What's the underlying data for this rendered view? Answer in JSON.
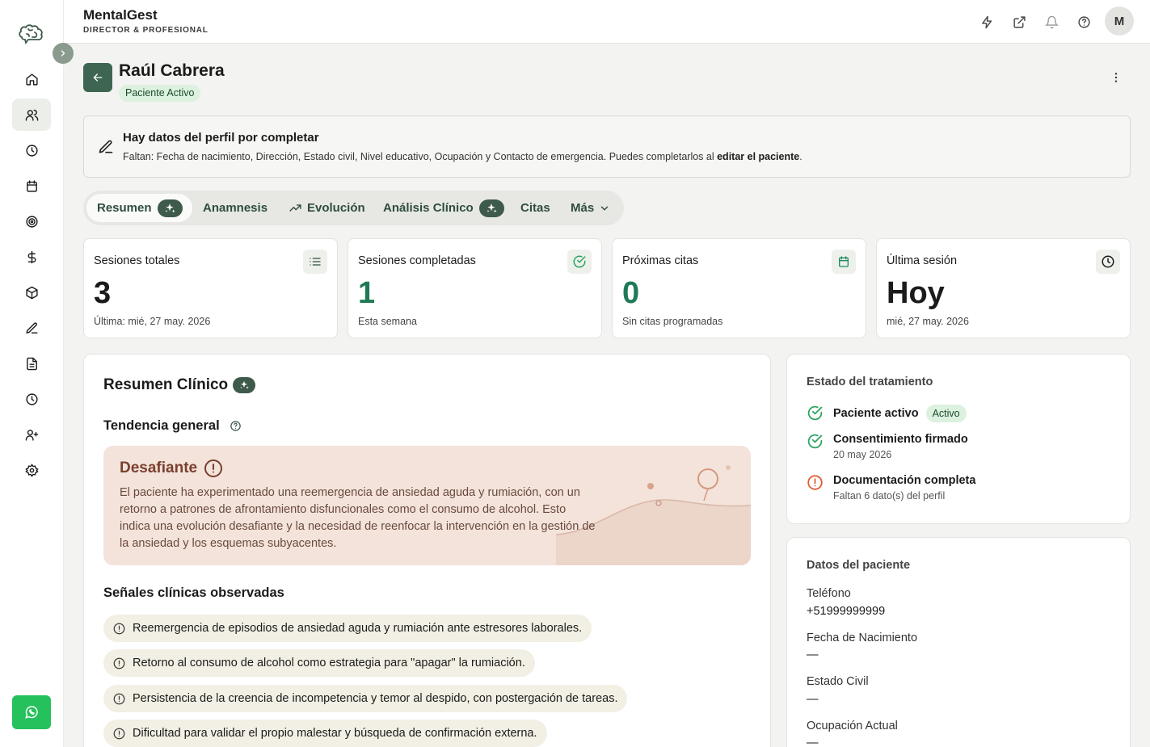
{
  "app": {
    "name": "MentalGest",
    "role": "DIRECTOR & PROFESIONAL",
    "avatar_initial": "M"
  },
  "sidebar": {
    "items": [
      {
        "icon": "home-icon"
      },
      {
        "icon": "users-icon",
        "active": true
      },
      {
        "icon": "clock-icon"
      },
      {
        "icon": "calendar-icon"
      },
      {
        "icon": "target-icon"
      },
      {
        "icon": "dollar-icon"
      },
      {
        "icon": "package-icon"
      },
      {
        "icon": "pen-icon"
      },
      {
        "icon": "document-icon"
      },
      {
        "icon": "history-icon"
      },
      {
        "icon": "user-plus-icon"
      },
      {
        "icon": "settings-icon"
      }
    ],
    "whatsapp_icon": "whatsapp-icon"
  },
  "topbar_icons": [
    "zap-icon",
    "external-link-icon",
    "bell-icon",
    "help-icon"
  ],
  "patient": {
    "name": "Raúl Cabrera",
    "status_badge": "Paciente Activo"
  },
  "notice": {
    "title": "Hay datos del perfil por completar",
    "text_prefix": "Faltan: Fecha de nacimiento, Dirección, Estado civil, Nivel educativo, Ocupación y Contacto de emergencia. Puedes completarlos al ",
    "text_link": "editar el paciente",
    "text_suffix": "."
  },
  "tabs": [
    {
      "label": "Resumen",
      "active": true,
      "sparkle": true
    },
    {
      "label": "Anamnesis"
    },
    {
      "label": "Evolución",
      "icon": "trending-up-icon"
    },
    {
      "label": "Análisis Clínico",
      "sparkle": true
    },
    {
      "label": "Citas"
    },
    {
      "label": "Más",
      "icon": "chevron-down-icon"
    }
  ],
  "stats": [
    {
      "title": "Sesiones totales",
      "value": "3",
      "sub": "Última: mié, 27 may. 2026",
      "icon": "list-icon",
      "color": "#1b1b1b"
    },
    {
      "title": "Sesiones completadas",
      "value": "1",
      "sub": "Esta semana",
      "icon": "check-circle-icon",
      "color": "#1f7a55"
    },
    {
      "title": "Próximas citas",
      "value": "0",
      "sub": "Sin citas programadas",
      "icon": "calendar-icon",
      "color": "#1f7a55"
    },
    {
      "title": "Última sesión",
      "value": "Hoy",
      "sub": "mié, 27 may. 2026",
      "icon": "clock-icon",
      "color": "#1b1b1b"
    }
  ],
  "clinical": {
    "title": "Resumen Clínico",
    "trend_title": "Tendencia general",
    "trend_label": "Desafiante",
    "trend_text": "El paciente ha experimentado una reemergencia de ansiedad aguda y rumiación, con un retorno a patrones de afrontamiento disfuncionales como el consumo de alcohol. Esto indica una evolución desafiante y la necesidad de reenfocar la intervención en la gestión de la ansiedad y los esquemas subyacentes.",
    "signals_title": "Señales clínicas observadas",
    "signals": [
      "Reemergencia de episodios de ansiedad aguda y rumiación ante estresores laborales.",
      "Retorno al consumo de alcohol como estrategia para \"apagar\" la rumiación.",
      "Persistencia de la creencia de incompetencia y temor al despido, con postergación de tareas.",
      "Dificultad para validar el propio malestar y búsqueda de confirmación externa."
    ]
  },
  "treatment": {
    "title": "Estado del tratamiento",
    "items": [
      {
        "label": "Paciente activo",
        "badge": "Activo",
        "sub": "",
        "state": "ok"
      },
      {
        "label": "Consentimiento firmado",
        "badge": "",
        "sub": "20 may 2026",
        "state": "ok"
      },
      {
        "label": "Documentación completa",
        "badge": "",
        "sub": "Faltan 6 dato(s) del perfil",
        "state": "warn"
      }
    ]
  },
  "patient_data": {
    "title": "Datos del paciente",
    "fields": [
      {
        "label": "Teléfono",
        "value": "+51999999999"
      },
      {
        "label": "Fecha de Nacimiento",
        "value": "—"
      },
      {
        "label": "Estado Civil",
        "value": "—"
      },
      {
        "label": "Ocupación Actual",
        "value": "—"
      }
    ]
  },
  "colors": {
    "primary": "#3e6551",
    "accent_green": "#1f7a55",
    "warn": "#e0582e",
    "trend_bg": "#f3e3da"
  }
}
